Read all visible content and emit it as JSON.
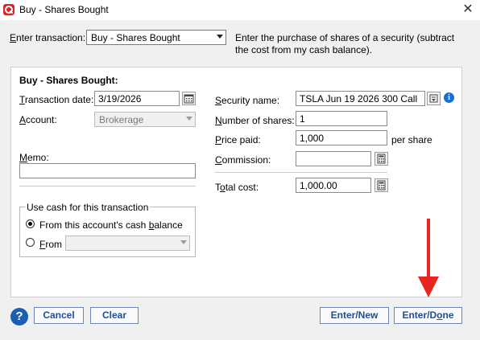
{
  "window": {
    "title": "Buy - Shares Bought",
    "close_glyph": "✕"
  },
  "enter_transaction": {
    "label_pre": "",
    "label_mnemonic": "E",
    "label_post": "nter transaction:",
    "value": "Buy - Shares Bought",
    "description": "Enter the purchase of shares of a security (subtract the cost from my cash balance)."
  },
  "panel": {
    "title": "Buy - Shares Bought:",
    "transaction_date": {
      "label_pre": "",
      "label_mnemonic": "T",
      "label_post": "ransaction date:",
      "value": "3/19/2026"
    },
    "account": {
      "label_pre": "",
      "label_mnemonic": "A",
      "label_post": "ccount:",
      "value": "Brokerage"
    },
    "memo": {
      "label_pre": "",
      "label_mnemonic": "M",
      "label_post": "emo:",
      "value": ""
    },
    "security_name": {
      "label_pre": "",
      "label_mnemonic": "S",
      "label_post": "ecurity name:",
      "value": "TSLA Jun 19 2026 300 Call"
    },
    "number_of_shares": {
      "label_pre": "",
      "label_mnemonic": "N",
      "label_post": "umber of shares:",
      "value": "1"
    },
    "price_paid": {
      "label_pre": "",
      "label_mnemonic": "P",
      "label_post": "rice paid:",
      "value": "1,000",
      "suffix": "per share"
    },
    "commission": {
      "label_pre": "",
      "label_mnemonic": "C",
      "label_post": "ommission:",
      "value": ""
    },
    "total_cost": {
      "label_pre": "T",
      "label_mnemonic": "o",
      "label_post": "tal cost:",
      "value": "1,000.00"
    },
    "cash_group": {
      "title": "Use cash for this transaction",
      "option_this_pre": "From this account's cash ",
      "option_this_mnemonic": "b",
      "option_this_post": "alance",
      "option_from_pre": "",
      "option_from_mnemonic": "F",
      "option_from_post": "rom",
      "from_value": ""
    }
  },
  "buttons": {
    "help": "?",
    "cancel": "Cancel",
    "clear": "Clear",
    "enter_new": "Enter/New",
    "enter_done_pre": "Enter/D",
    "enter_done_mnemonic": "o",
    "enter_done_post": "ne"
  },
  "colors": {
    "arrow": "#e8251f",
    "accent": "#1a5fb4",
    "brand": "#d9262c"
  }
}
